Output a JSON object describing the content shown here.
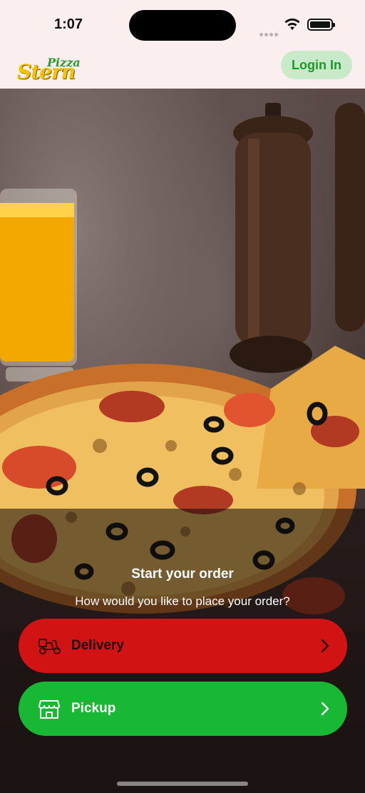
{
  "status_bar": {
    "time": "1:07",
    "icons": [
      "cellular-dots-icon",
      "wifi-icon",
      "battery-icon"
    ]
  },
  "header": {
    "logo_top": "Pizza",
    "logo_main": "Stern",
    "login_label": "Login In"
  },
  "order": {
    "title": "Start your order",
    "subtitle": "How would you like to place your order?",
    "options": [
      {
        "label": "Delivery",
        "icon": "scooter-icon",
        "color": "#d21313"
      },
      {
        "label": "Pickup",
        "icon": "store-icon",
        "color": "#19b834"
      }
    ]
  },
  "colors": {
    "header_bg": "#fbeeee",
    "login_bg": "#c9eac8",
    "login_text": "#1a9a2a",
    "delivery": "#d21313",
    "pickup": "#19b834"
  }
}
